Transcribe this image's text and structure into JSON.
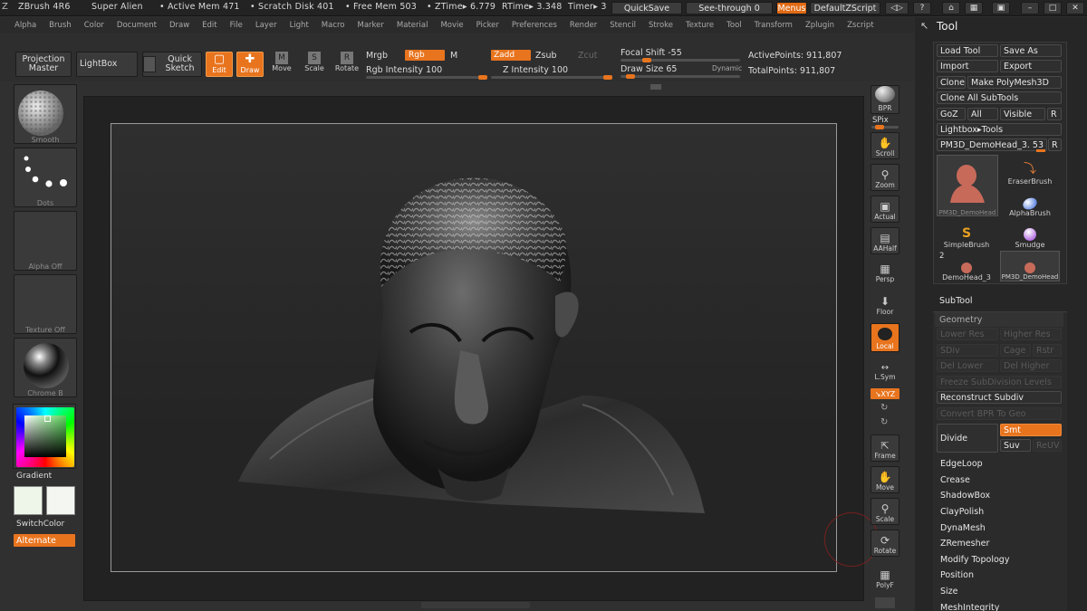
{
  "titlebar": {
    "app": "ZBrush 4R6",
    "project": "Super Alien",
    "active_mem": "• Active Mem 471",
    "scratch": "• Scratch Disk 401",
    "free_mem": "• Free Mem 503",
    "ztime": "• ZTime▸ 6.779",
    "rtime": "RTime▸ 3.348",
    "timer": "Timer▸ 3",
    "quicksave": "QuickSave",
    "seethrough": "See-through  0",
    "menus": "Menus",
    "script": "DefaultZScript"
  },
  "menubar": [
    "Alpha",
    "Brush",
    "Color",
    "Document",
    "Draw",
    "Edit",
    "File",
    "Layer",
    "Light",
    "Macro",
    "Marker",
    "Material",
    "Movie",
    "Picker",
    "Preferences",
    "Render",
    "Stencil",
    "Stroke",
    "Texture",
    "Tool",
    "Transform",
    "Zplugin",
    "Zscript"
  ],
  "shelf": {
    "projection_master": "Projection Master",
    "lightbox": "LightBox",
    "quick_sketch": "Quick Sketch",
    "edit": "Edit",
    "draw": "Draw",
    "move": "Move",
    "scale": "Scale",
    "rotate": "Rotate",
    "mrgb": "Mrgb",
    "rgb": "Rgb",
    "m": "M",
    "rgb_intensity": "Rgb Intensity 100",
    "zadd": "Zadd",
    "zsub": "Zsub",
    "zcut": "Zcut",
    "z_intensity": "Z Intensity 100",
    "focal_shift": "Focal Shift -55",
    "draw_size": "Draw Size 65",
    "dynamic": "Dynamic",
    "active_points": "ActivePoints: 911,807",
    "total_points": "TotalPoints: 911,807",
    "rgb_intensity_level": 1.0,
    "z_intensity_level": 1.0,
    "focal_shift_level": 0.22,
    "draw_size_level": 0.08
  },
  "leftpanel": {
    "brush": "Smooth",
    "stroke": "Dots",
    "alpha": "Alpha  Off",
    "texture": "Texture  Off",
    "material": "Chrome  B",
    "gradient": "Gradient",
    "switchcolor": "SwitchColor",
    "alternate": "Alternate"
  },
  "righttools": {
    "bpr": "BPR",
    "spix": "SPix",
    "scroll": "Scroll",
    "zoom": "Zoom",
    "actual": "Actual",
    "aahalf": "AAHalf",
    "persp": "Persp",
    "floor": "Floor",
    "local": "Local",
    "lsym": "L.Sym",
    "xyz": "↘XYZ",
    "frame": "Frame",
    "move": "Move",
    "scale": "Scale",
    "rotate": "Rotate",
    "polyf": "PolyF"
  },
  "toolpalette": {
    "title": "Tool",
    "load_tool": "Load Tool",
    "save_as": "Save As",
    "import": "Import",
    "export": "Export",
    "clone": "Clone",
    "make_polymesh": "Make PolyMesh3D",
    "clone_all": "Clone  All SubTools",
    "goz": "GoZ",
    "all": "All",
    "visible": "Visible",
    "r": "R",
    "lightbox_tools": "Lightbox▸Tools",
    "current_tool": "PM3D_DemoHead_3. 53",
    "brushes": [
      {
        "name": "PM3D_DemoHead",
        "icon": "head-icon"
      },
      {
        "name": "EraserBrush",
        "icon": "eraser-icon"
      },
      {
        "name": "AlphaBrush",
        "icon": "alpha-brush-icon"
      },
      {
        "name": "SimpleBrush",
        "icon": "simple-brush-icon"
      },
      {
        "name": "Smudge",
        "icon": "smudge-icon"
      },
      {
        "name": "DemoHead_3",
        "icon": "head-icon"
      },
      {
        "name": "PM3D_DemoHead",
        "icon": "head-icon"
      }
    ],
    "count_badge": "2",
    "subtool": "SubTool",
    "geometry": "Geometry",
    "lower_res": "Lower Res",
    "higher_res": "Higher Res",
    "sdiv": "SDiv",
    "cage": "Cage",
    "rstr": "Rstr",
    "del_lower": "Del Lower",
    "del_higher": "Del Higher",
    "freeze": "Freeze SubDivision Levels",
    "reconstruct": "Reconstruct Subdiv",
    "convert_bpr": "Convert BPR To Geo",
    "divide": "Divide",
    "smt": "Smt",
    "suv": "Suv",
    "reuv": "ReUV",
    "sections": [
      "EdgeLoop",
      "Crease",
      "ShadowBox",
      "ClayPolish",
      "DynaMesh",
      "ZRemesher",
      "Modify Topology",
      "Position",
      "Size",
      "MeshIntegrity"
    ]
  },
  "colors": {
    "accent": "#e8741e",
    "bg": "#303030",
    "panel": "#262626"
  }
}
